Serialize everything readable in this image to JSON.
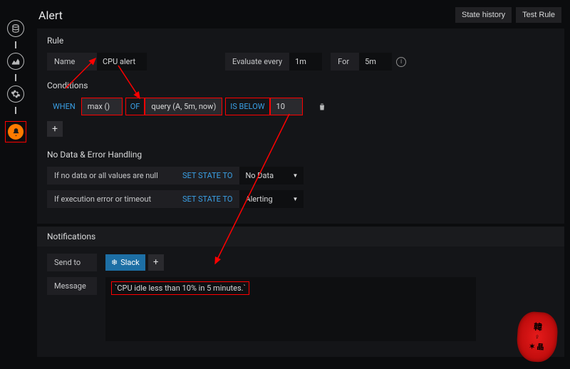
{
  "header": {
    "title": "Alert",
    "buttons": {
      "state_history": "State history",
      "test_rule": "Test Rule"
    }
  },
  "rule": {
    "section": "Rule",
    "name_label": "Name",
    "name_value": "CPU alert",
    "evaluate_label": "Evaluate every",
    "evaluate_value": "1m",
    "for_label": "For",
    "for_value": "5m"
  },
  "conditions": {
    "section": "Conditions",
    "when": "WHEN",
    "func": "max ()",
    "of": "OF",
    "query": "query (A, 5m, now)",
    "is_below": "IS BELOW",
    "threshold": "10"
  },
  "nodata": {
    "section": "No Data & Error Handling",
    "row1_label": "If no data or all values are null",
    "row2_label": "If execution error or timeout",
    "set_state": "SET STATE TO",
    "state1": "No Data",
    "state2": "Alerting"
  },
  "notifications": {
    "section": "Notifications",
    "sendto_label": "Send to",
    "slack_label": "Slack",
    "message_label": "Message",
    "message_value": "`CPU idle less than 10% in 5 minutes.`"
  },
  "icons": {
    "info": "i",
    "plus": "+",
    "snow": "❄"
  }
}
